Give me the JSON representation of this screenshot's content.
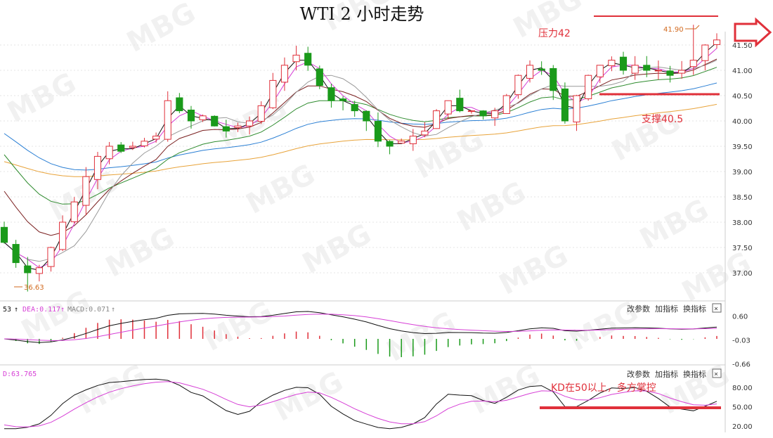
{
  "title": "WTI 2 小时走势",
  "colors": {
    "up": "#e0303a",
    "down": "#1a9a1a",
    "ma5": "#111111",
    "ma10": "#d63fd6",
    "ma20": "#999999",
    "ma30": "#7a1f1f",
    "ma60": "#2e8b2e",
    "ma120": "#2a7fd4",
    "ma250": "#e8a33a",
    "k": "#111111",
    "d": "#d63fd6",
    "annotation": "#e0303a"
  },
  "annotations": {
    "resistance": "压力42",
    "support": "支撑40.5",
    "high_label": "41.90",
    "low_label": "36.63",
    "kd_note": "KD在50以上，多方掌控"
  },
  "watermark": "MBG",
  "macd_panel": {
    "legend_prefix": "53",
    "dea": "DEA:0.117",
    "macd": "MACD:0.071",
    "buttons": [
      "改参数",
      "加指标",
      "换指标"
    ],
    "close": "×",
    "ticks": [
      "0.60",
      "-0.03",
      "-0.66"
    ]
  },
  "kd_panel": {
    "legend": "D:63.765",
    "buttons": [
      "改参数",
      "加指标",
      "换指标"
    ],
    "close": "×",
    "ticks": [
      "80.00",
      "50.00",
      "20.00"
    ]
  },
  "chart_data": {
    "type": "candlestick",
    "symbol": "WTI",
    "timeframe": "2H",
    "y_ticks": [
      41.5,
      41.0,
      40.5,
      40.0,
      39.5,
      39.0,
      38.5,
      38.0,
      37.5,
      37.0
    ],
    "ylim": [
      36.6,
      42.2
    ],
    "levels": {
      "resistance": 42.0,
      "support": 40.5
    },
    "extremes": {
      "high": 41.9,
      "low": 36.63
    },
    "close_path": [
      37.6,
      37.2,
      37.0,
      37.1,
      37.5,
      38.0,
      38.4,
      38.9,
      39.3,
      39.5,
      39.4,
      39.5,
      39.6,
      39.7,
      40.4,
      40.2,
      40.0,
      40.1,
      39.9,
      39.8,
      39.9,
      40.0,
      40.3,
      40.8,
      41.1,
      41.3,
      41.1,
      40.7,
      40.4,
      40.4,
      40.2,
      40.0,
      39.6,
      39.5,
      39.6,
      39.7,
      39.8,
      40.2,
      40.4,
      40.2,
      40.2,
      40.1,
      40.2,
      40.5,
      40.9,
      41.1,
      41.0,
      40.6,
      40.0,
      40.5,
      40.9,
      41.1,
      41.2,
      41.0,
      41.1,
      41.0,
      41.0,
      40.9,
      41.0,
      41.2,
      41.5,
      41.6
    ],
    "ma5_final": 41.1,
    "ma10_final": 41.2,
    "ma20_final": 41.05,
    "ma30_final": 41.0,
    "ma60_final": 40.7,
    "ma120_final": 40.35,
    "ma250_final": 39.95,
    "kd_levels": [
      80,
      50,
      20
    ],
    "kd_reference": 50,
    "macd_ticks": [
      0.6,
      -0.03,
      -0.66
    ]
  }
}
